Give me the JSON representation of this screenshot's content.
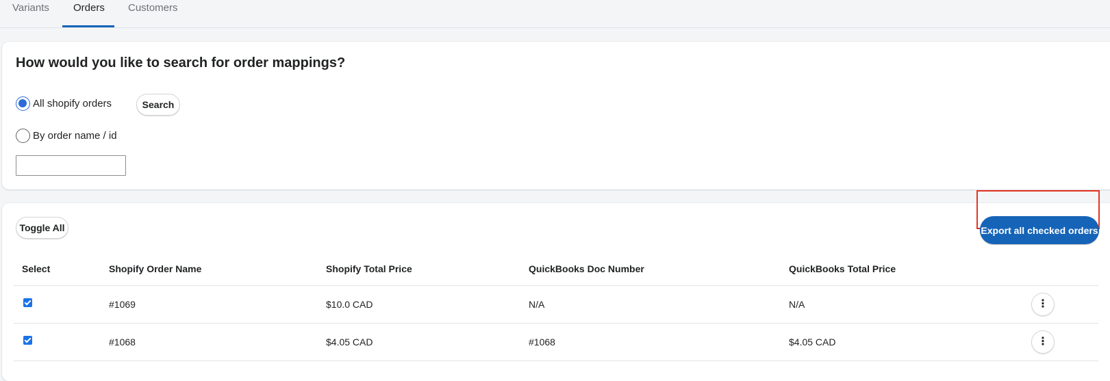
{
  "tabs": [
    {
      "label": "Variants"
    },
    {
      "label": "Orders"
    },
    {
      "label": "Customers"
    }
  ],
  "search_card": {
    "heading": "How would you like to search for order mappings?",
    "radio_all_label": "All shopify orders",
    "radio_by_name_label": "By order name / id",
    "search_button": "Search",
    "input_value": ""
  },
  "orders_card": {
    "toggle_all_button": "Toggle All",
    "export_button": "Export all checked orders",
    "columns": [
      "Select",
      "Shopify Order Name",
      "Shopify Total Price",
      "QuickBooks Doc Number",
      "QuickBooks Total Price"
    ],
    "rows": [
      {
        "order_name": "#1069",
        "shopify_total": "$10.0 CAD",
        "qb_doc": "N/A",
        "qb_total": "N/A"
      },
      {
        "order_name": "#1068",
        "shopify_total": "$4.05 CAD",
        "qb_doc": "#1068",
        "qb_total": "$4.05 CAD"
      }
    ],
    "more_icon": "more-vertical-icon"
  },
  "colors": {
    "accent": "#1564b8",
    "highlight_outline": "#e53323",
    "radio_checked": "#2d6bd8"
  }
}
